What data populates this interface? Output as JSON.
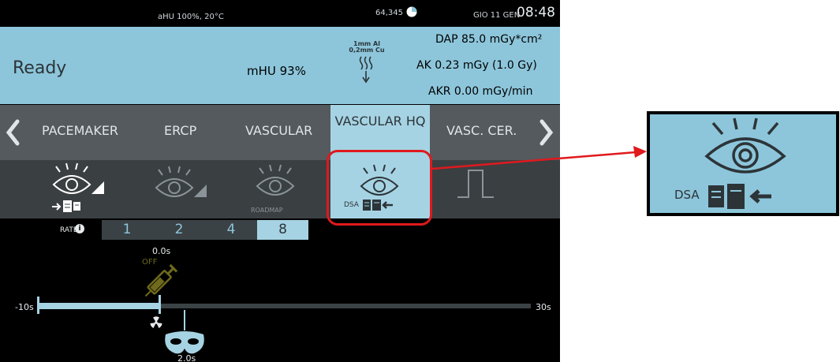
{
  "status_bar": {
    "humidity": "aHU 100%, 20°C",
    "counter": "64,345",
    "date": "GIO 11 GEN",
    "time": "08:48"
  },
  "info_panel": {
    "status": "Ready",
    "mhu": "mHU 93%",
    "filter_line1": "1mm Al",
    "filter_line2": "0,2mm Cu",
    "dap": "DAP 85.0 mGy*cm²",
    "ak": "AK 0.23 mGy  (1.0 Gy)",
    "akr": "AKR  0.00 mGy/min"
  },
  "tabs": {
    "items": [
      "PACEMAKER",
      "ERCP",
      "VASCULAR",
      "VASCULAR HQ",
      "VASC. CER."
    ],
    "active": "VASCULAR HQ"
  },
  "modes": {
    "roadmap_label": "ROADMAP",
    "dsa_label": "DSA",
    "selected": "DSA"
  },
  "rate": {
    "label": "RATE",
    "info_glyph": "i",
    "options": [
      "1",
      "2",
      "4",
      "8"
    ],
    "selected": "8"
  },
  "timeline": {
    "start": "-10s",
    "end": "30s",
    "injection_time": "0.0s",
    "injector_state": "OFF",
    "mask_time": "2.0s"
  },
  "zoom": {
    "label": "DSA"
  },
  "colors": {
    "panel_blue": "#8dc6db",
    "active_blue": "#a6d3e3",
    "highlight_red": "#e0191d"
  }
}
